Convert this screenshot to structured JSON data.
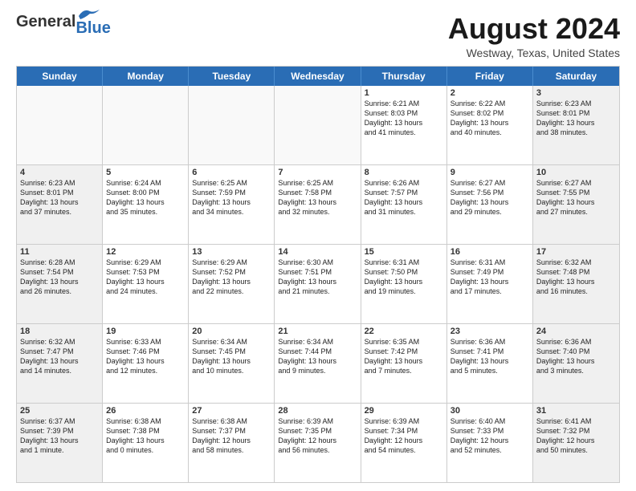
{
  "header": {
    "logo_general": "General",
    "logo_blue": "Blue",
    "title": "August 2024",
    "subtitle": "Westway, Texas, United States"
  },
  "day_headers": [
    "Sunday",
    "Monday",
    "Tuesday",
    "Wednesday",
    "Thursday",
    "Friday",
    "Saturday"
  ],
  "weeks": [
    [
      {
        "num": "",
        "info": "",
        "empty": true
      },
      {
        "num": "",
        "info": "",
        "empty": true
      },
      {
        "num": "",
        "info": "",
        "empty": true
      },
      {
        "num": "",
        "info": "",
        "empty": true
      },
      {
        "num": "1",
        "info": "Sunrise: 6:21 AM\nSunset: 8:03 PM\nDaylight: 13 hours\nand 41 minutes.",
        "empty": false
      },
      {
        "num": "2",
        "info": "Sunrise: 6:22 AM\nSunset: 8:02 PM\nDaylight: 13 hours\nand 40 minutes.",
        "empty": false
      },
      {
        "num": "3",
        "info": "Sunrise: 6:23 AM\nSunset: 8:01 PM\nDaylight: 13 hours\nand 38 minutes.",
        "empty": false
      }
    ],
    [
      {
        "num": "4",
        "info": "Sunrise: 6:23 AM\nSunset: 8:01 PM\nDaylight: 13 hours\nand 37 minutes.",
        "empty": false
      },
      {
        "num": "5",
        "info": "Sunrise: 6:24 AM\nSunset: 8:00 PM\nDaylight: 13 hours\nand 35 minutes.",
        "empty": false
      },
      {
        "num": "6",
        "info": "Sunrise: 6:25 AM\nSunset: 7:59 PM\nDaylight: 13 hours\nand 34 minutes.",
        "empty": false
      },
      {
        "num": "7",
        "info": "Sunrise: 6:25 AM\nSunset: 7:58 PM\nDaylight: 13 hours\nand 32 minutes.",
        "empty": false
      },
      {
        "num": "8",
        "info": "Sunrise: 6:26 AM\nSunset: 7:57 PM\nDaylight: 13 hours\nand 31 minutes.",
        "empty": false
      },
      {
        "num": "9",
        "info": "Sunrise: 6:27 AM\nSunset: 7:56 PM\nDaylight: 13 hours\nand 29 minutes.",
        "empty": false
      },
      {
        "num": "10",
        "info": "Sunrise: 6:27 AM\nSunset: 7:55 PM\nDaylight: 13 hours\nand 27 minutes.",
        "empty": false
      }
    ],
    [
      {
        "num": "11",
        "info": "Sunrise: 6:28 AM\nSunset: 7:54 PM\nDaylight: 13 hours\nand 26 minutes.",
        "empty": false
      },
      {
        "num": "12",
        "info": "Sunrise: 6:29 AM\nSunset: 7:53 PM\nDaylight: 13 hours\nand 24 minutes.",
        "empty": false
      },
      {
        "num": "13",
        "info": "Sunrise: 6:29 AM\nSunset: 7:52 PM\nDaylight: 13 hours\nand 22 minutes.",
        "empty": false
      },
      {
        "num": "14",
        "info": "Sunrise: 6:30 AM\nSunset: 7:51 PM\nDaylight: 13 hours\nand 21 minutes.",
        "empty": false
      },
      {
        "num": "15",
        "info": "Sunrise: 6:31 AM\nSunset: 7:50 PM\nDaylight: 13 hours\nand 19 minutes.",
        "empty": false
      },
      {
        "num": "16",
        "info": "Sunrise: 6:31 AM\nSunset: 7:49 PM\nDaylight: 13 hours\nand 17 minutes.",
        "empty": false
      },
      {
        "num": "17",
        "info": "Sunrise: 6:32 AM\nSunset: 7:48 PM\nDaylight: 13 hours\nand 16 minutes.",
        "empty": false
      }
    ],
    [
      {
        "num": "18",
        "info": "Sunrise: 6:32 AM\nSunset: 7:47 PM\nDaylight: 13 hours\nand 14 minutes.",
        "empty": false
      },
      {
        "num": "19",
        "info": "Sunrise: 6:33 AM\nSunset: 7:46 PM\nDaylight: 13 hours\nand 12 minutes.",
        "empty": false
      },
      {
        "num": "20",
        "info": "Sunrise: 6:34 AM\nSunset: 7:45 PM\nDaylight: 13 hours\nand 10 minutes.",
        "empty": false
      },
      {
        "num": "21",
        "info": "Sunrise: 6:34 AM\nSunset: 7:44 PM\nDaylight: 13 hours\nand 9 minutes.",
        "empty": false
      },
      {
        "num": "22",
        "info": "Sunrise: 6:35 AM\nSunset: 7:42 PM\nDaylight: 13 hours\nand 7 minutes.",
        "empty": false
      },
      {
        "num": "23",
        "info": "Sunrise: 6:36 AM\nSunset: 7:41 PM\nDaylight: 13 hours\nand 5 minutes.",
        "empty": false
      },
      {
        "num": "24",
        "info": "Sunrise: 6:36 AM\nSunset: 7:40 PM\nDaylight: 13 hours\nand 3 minutes.",
        "empty": false
      }
    ],
    [
      {
        "num": "25",
        "info": "Sunrise: 6:37 AM\nSunset: 7:39 PM\nDaylight: 13 hours\nand 1 minute.",
        "empty": false
      },
      {
        "num": "26",
        "info": "Sunrise: 6:38 AM\nSunset: 7:38 PM\nDaylight: 13 hours\nand 0 minutes.",
        "empty": false
      },
      {
        "num": "27",
        "info": "Sunrise: 6:38 AM\nSunset: 7:37 PM\nDaylight: 12 hours\nand 58 minutes.",
        "empty": false
      },
      {
        "num": "28",
        "info": "Sunrise: 6:39 AM\nSunset: 7:35 PM\nDaylight: 12 hours\nand 56 minutes.",
        "empty": false
      },
      {
        "num": "29",
        "info": "Sunrise: 6:39 AM\nSunset: 7:34 PM\nDaylight: 12 hours\nand 54 minutes.",
        "empty": false
      },
      {
        "num": "30",
        "info": "Sunrise: 6:40 AM\nSunset: 7:33 PM\nDaylight: 12 hours\nand 52 minutes.",
        "empty": false
      },
      {
        "num": "31",
        "info": "Sunrise: 6:41 AM\nSunset: 7:32 PM\nDaylight: 12 hours\nand 50 minutes.",
        "empty": false
      }
    ]
  ]
}
